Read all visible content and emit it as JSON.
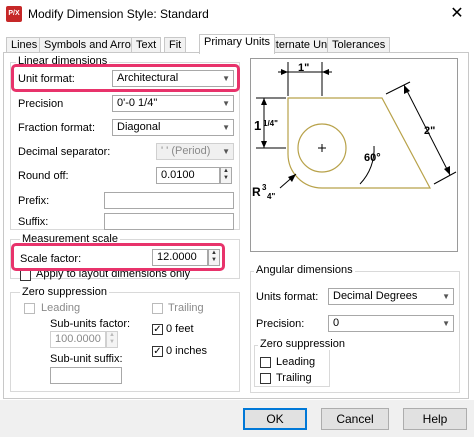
{
  "window": {
    "title": "Modify Dimension Style: Standard",
    "app_icon_text": "P/X",
    "close_glyph": "✕"
  },
  "tabs": [
    {
      "label": "Lines"
    },
    {
      "label": "Symbols and Arrows"
    },
    {
      "label": "Text"
    },
    {
      "label": "Fit"
    },
    {
      "label": "Primary Units",
      "active": true
    },
    {
      "label": "Alternate Units"
    },
    {
      "label": "Tolerances"
    }
  ],
  "linear_dimensions": {
    "group_label": "Linear dimensions",
    "unit_format": {
      "label": "Unit format:",
      "value": "Architectural"
    },
    "precision": {
      "label": "Precision",
      "value": "0'-0 1/4\""
    },
    "fraction_format": {
      "label": "Fraction format:",
      "value": "Diagonal"
    },
    "decimal_separator": {
      "label": "Decimal separator:",
      "value": "' ' (Period)"
    },
    "round_off": {
      "label": "Round off:",
      "value": "0.0100"
    },
    "prefix": {
      "label": "Prefix:",
      "value": ""
    },
    "suffix": {
      "label": "Suffix:",
      "value": ""
    }
  },
  "measurement_scale": {
    "group_label": "Measurement scale",
    "scale_factor": {
      "label": "Scale factor:",
      "value": "12.0000"
    },
    "apply_layout": {
      "label": "Apply to layout dimensions only",
      "checked": false
    }
  },
  "zero_suppression_linear": {
    "group_label": "Zero suppression",
    "leading": {
      "label": "Leading",
      "checked": false
    },
    "trailing": {
      "label": "Trailing",
      "checked": false
    },
    "sub_units_factor": {
      "label": "Sub-units factor:",
      "value": "100.0000"
    },
    "sub_unit_suffix": {
      "label": "Sub-unit suffix:",
      "value": ""
    },
    "zero_feet": {
      "label": "0 feet",
      "checked": true
    },
    "zero_inches": {
      "label": "0 inches",
      "checked": true
    }
  },
  "preview": {
    "dim_top": "1\"",
    "dim_left_whole": "1",
    "dim_left_frac": "1/4\"",
    "dim_right": "2\"",
    "dim_angle": "60°",
    "dim_radius": "R3/4\"",
    "dim_radius_prefix": "R",
    "dim_radius_num": "3",
    "dim_radius_den": "4\""
  },
  "angular_dimensions": {
    "group_label": "Angular dimensions",
    "units_format": {
      "label": "Units format:",
      "value": "Decimal Degrees"
    },
    "precision": {
      "label": "Precision:",
      "value": "0"
    },
    "zero_suppression": {
      "group_label": "Zero suppression",
      "leading": {
        "label": "Leading",
        "checked": false
      },
      "trailing": {
        "label": "Trailing",
        "checked": false
      }
    }
  },
  "buttons": {
    "ok": "OK",
    "cancel": "Cancel",
    "help": "Help"
  },
  "colors": {
    "highlight": "#e8336b",
    "accent": "#0078d7",
    "preview_shape": "#b8a24a"
  }
}
